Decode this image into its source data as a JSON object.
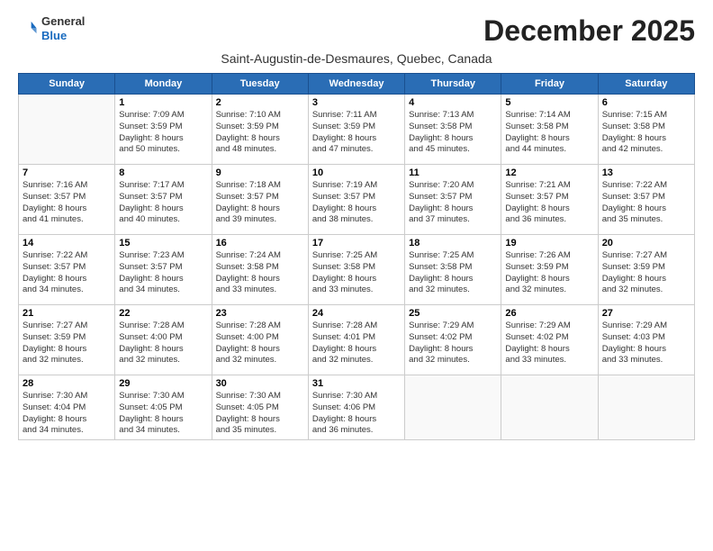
{
  "logo": {
    "general": "General",
    "blue": "Blue"
  },
  "title": "December 2025",
  "subtitle": "Saint-Augustin-de-Desmaures, Quebec, Canada",
  "headers": [
    "Sunday",
    "Monday",
    "Tuesday",
    "Wednesday",
    "Thursday",
    "Friday",
    "Saturday"
  ],
  "weeks": [
    [
      {
        "date": "",
        "text": ""
      },
      {
        "date": "1",
        "text": "Sunrise: 7:09 AM\nSunset: 3:59 PM\nDaylight: 8 hours\nand 50 minutes."
      },
      {
        "date": "2",
        "text": "Sunrise: 7:10 AM\nSunset: 3:59 PM\nDaylight: 8 hours\nand 48 minutes."
      },
      {
        "date": "3",
        "text": "Sunrise: 7:11 AM\nSunset: 3:59 PM\nDaylight: 8 hours\nand 47 minutes."
      },
      {
        "date": "4",
        "text": "Sunrise: 7:13 AM\nSunset: 3:58 PM\nDaylight: 8 hours\nand 45 minutes."
      },
      {
        "date": "5",
        "text": "Sunrise: 7:14 AM\nSunset: 3:58 PM\nDaylight: 8 hours\nand 44 minutes."
      },
      {
        "date": "6",
        "text": "Sunrise: 7:15 AM\nSunset: 3:58 PM\nDaylight: 8 hours\nand 42 minutes."
      }
    ],
    [
      {
        "date": "7",
        "text": "Sunrise: 7:16 AM\nSunset: 3:57 PM\nDaylight: 8 hours\nand 41 minutes."
      },
      {
        "date": "8",
        "text": "Sunrise: 7:17 AM\nSunset: 3:57 PM\nDaylight: 8 hours\nand 40 minutes."
      },
      {
        "date": "9",
        "text": "Sunrise: 7:18 AM\nSunset: 3:57 PM\nDaylight: 8 hours\nand 39 minutes."
      },
      {
        "date": "10",
        "text": "Sunrise: 7:19 AM\nSunset: 3:57 PM\nDaylight: 8 hours\nand 38 minutes."
      },
      {
        "date": "11",
        "text": "Sunrise: 7:20 AM\nSunset: 3:57 PM\nDaylight: 8 hours\nand 37 minutes."
      },
      {
        "date": "12",
        "text": "Sunrise: 7:21 AM\nSunset: 3:57 PM\nDaylight: 8 hours\nand 36 minutes."
      },
      {
        "date": "13",
        "text": "Sunrise: 7:22 AM\nSunset: 3:57 PM\nDaylight: 8 hours\nand 35 minutes."
      }
    ],
    [
      {
        "date": "14",
        "text": "Sunrise: 7:22 AM\nSunset: 3:57 PM\nDaylight: 8 hours\nand 34 minutes."
      },
      {
        "date": "15",
        "text": "Sunrise: 7:23 AM\nSunset: 3:57 PM\nDaylight: 8 hours\nand 34 minutes."
      },
      {
        "date": "16",
        "text": "Sunrise: 7:24 AM\nSunset: 3:58 PM\nDaylight: 8 hours\nand 33 minutes."
      },
      {
        "date": "17",
        "text": "Sunrise: 7:25 AM\nSunset: 3:58 PM\nDaylight: 8 hours\nand 33 minutes."
      },
      {
        "date": "18",
        "text": "Sunrise: 7:25 AM\nSunset: 3:58 PM\nDaylight: 8 hours\nand 32 minutes."
      },
      {
        "date": "19",
        "text": "Sunrise: 7:26 AM\nSunset: 3:59 PM\nDaylight: 8 hours\nand 32 minutes."
      },
      {
        "date": "20",
        "text": "Sunrise: 7:27 AM\nSunset: 3:59 PM\nDaylight: 8 hours\nand 32 minutes."
      }
    ],
    [
      {
        "date": "21",
        "text": "Sunrise: 7:27 AM\nSunset: 3:59 PM\nDaylight: 8 hours\nand 32 minutes."
      },
      {
        "date": "22",
        "text": "Sunrise: 7:28 AM\nSunset: 4:00 PM\nDaylight: 8 hours\nand 32 minutes."
      },
      {
        "date": "23",
        "text": "Sunrise: 7:28 AM\nSunset: 4:00 PM\nDaylight: 8 hours\nand 32 minutes."
      },
      {
        "date": "24",
        "text": "Sunrise: 7:28 AM\nSunset: 4:01 PM\nDaylight: 8 hours\nand 32 minutes."
      },
      {
        "date": "25",
        "text": "Sunrise: 7:29 AM\nSunset: 4:02 PM\nDaylight: 8 hours\nand 32 minutes."
      },
      {
        "date": "26",
        "text": "Sunrise: 7:29 AM\nSunset: 4:02 PM\nDaylight: 8 hours\nand 33 minutes."
      },
      {
        "date": "27",
        "text": "Sunrise: 7:29 AM\nSunset: 4:03 PM\nDaylight: 8 hours\nand 33 minutes."
      }
    ],
    [
      {
        "date": "28",
        "text": "Sunrise: 7:30 AM\nSunset: 4:04 PM\nDaylight: 8 hours\nand 34 minutes."
      },
      {
        "date": "29",
        "text": "Sunrise: 7:30 AM\nSunset: 4:05 PM\nDaylight: 8 hours\nand 34 minutes."
      },
      {
        "date": "30",
        "text": "Sunrise: 7:30 AM\nSunset: 4:05 PM\nDaylight: 8 hours\nand 35 minutes."
      },
      {
        "date": "31",
        "text": "Sunrise: 7:30 AM\nSunset: 4:06 PM\nDaylight: 8 hours\nand 36 minutes."
      },
      {
        "date": "",
        "text": ""
      },
      {
        "date": "",
        "text": ""
      },
      {
        "date": "",
        "text": ""
      }
    ]
  ]
}
